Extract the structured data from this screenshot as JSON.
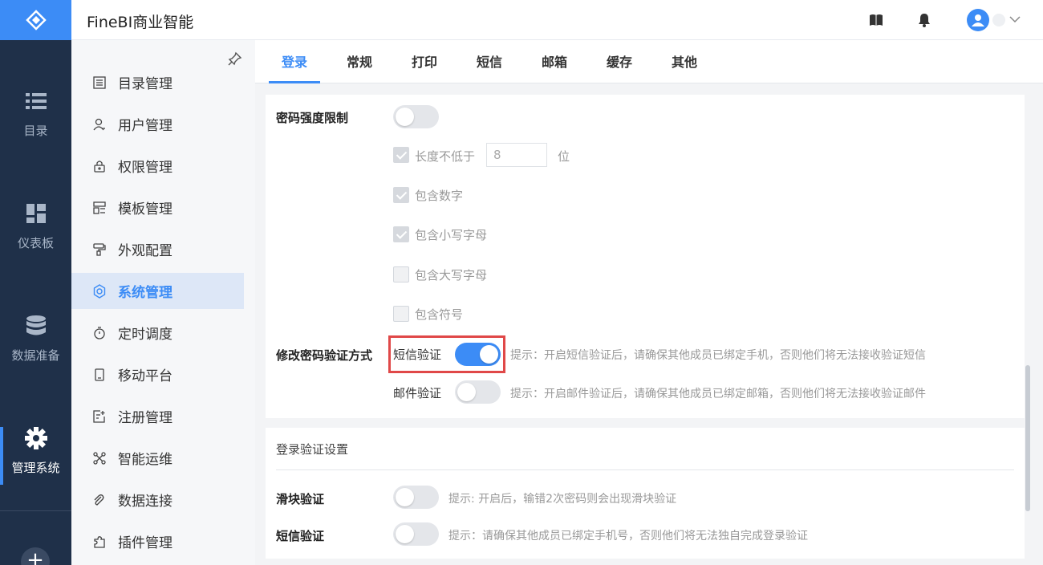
{
  "app": {
    "title": "FineBI商业智能"
  },
  "rail": {
    "items": [
      {
        "label": "目录",
        "icon": "list-icon"
      },
      {
        "label": "仪表板",
        "icon": "dashboard-icon"
      },
      {
        "label": "数据准备",
        "icon": "database-icon"
      },
      {
        "label": "管理系统",
        "icon": "gear-icon",
        "active": true
      }
    ]
  },
  "sidebar": {
    "items": [
      {
        "label": "目录管理",
        "icon": "catalog-icon"
      },
      {
        "label": "用户管理",
        "icon": "user-icon"
      },
      {
        "label": "权限管理",
        "icon": "lock-icon"
      },
      {
        "label": "模板管理",
        "icon": "template-icon"
      },
      {
        "label": "外观配置",
        "icon": "paint-icon"
      },
      {
        "label": "系统管理",
        "icon": "settings-icon",
        "active": true
      },
      {
        "label": "定时调度",
        "icon": "timer-icon"
      },
      {
        "label": "移动平台",
        "icon": "mobile-icon"
      },
      {
        "label": "注册管理",
        "icon": "register-icon"
      },
      {
        "label": "智能运维",
        "icon": "ops-icon"
      },
      {
        "label": "数据连接",
        "icon": "link-icon"
      },
      {
        "label": "插件管理",
        "icon": "plugin-icon"
      }
    ]
  },
  "tabs": [
    {
      "label": "登录",
      "active": true
    },
    {
      "label": "常规"
    },
    {
      "label": "打印"
    },
    {
      "label": "短信"
    },
    {
      "label": "邮箱"
    },
    {
      "label": "缓存"
    },
    {
      "label": "其他"
    }
  ],
  "password": {
    "label": "密码强度限制",
    "enabled": false,
    "options": [
      {
        "label": "长度不低于",
        "checked": true,
        "value": "8",
        "unit": "位"
      },
      {
        "label": "包含数字",
        "checked": true
      },
      {
        "label": "包含小写字母",
        "checked": true
      },
      {
        "label": "包含大写字母",
        "checked": false
      },
      {
        "label": "包含符号",
        "checked": false
      }
    ]
  },
  "change_verify": {
    "label": "修改密码验证方式",
    "sms": {
      "label": "短信验证",
      "enabled": true,
      "hint": "提示：开启短信验证后，请确保其他成员已绑定手机，否则他们将无法接收验证短信"
    },
    "email": {
      "label": "邮件验证",
      "enabled": false,
      "hint": "提示：开启邮件验证后，请确保其他成员已绑定邮箱，否则他们将无法接收验证邮件"
    }
  },
  "login_verify": {
    "title": "登录验证设置",
    "slider": {
      "label": "滑块验证",
      "enabled": false,
      "hint": "提示: 开启后，输错2次密码则会出现滑块验证"
    },
    "sms": {
      "label": "短信验证",
      "enabled": false,
      "hint": "提示：请确保其他成员已绑定手机号，否则他们将无法独自完成登录验证"
    }
  },
  "colors": {
    "accent": "#3c8cf6",
    "rail": "#1f3049",
    "highlight": "#e04848"
  }
}
